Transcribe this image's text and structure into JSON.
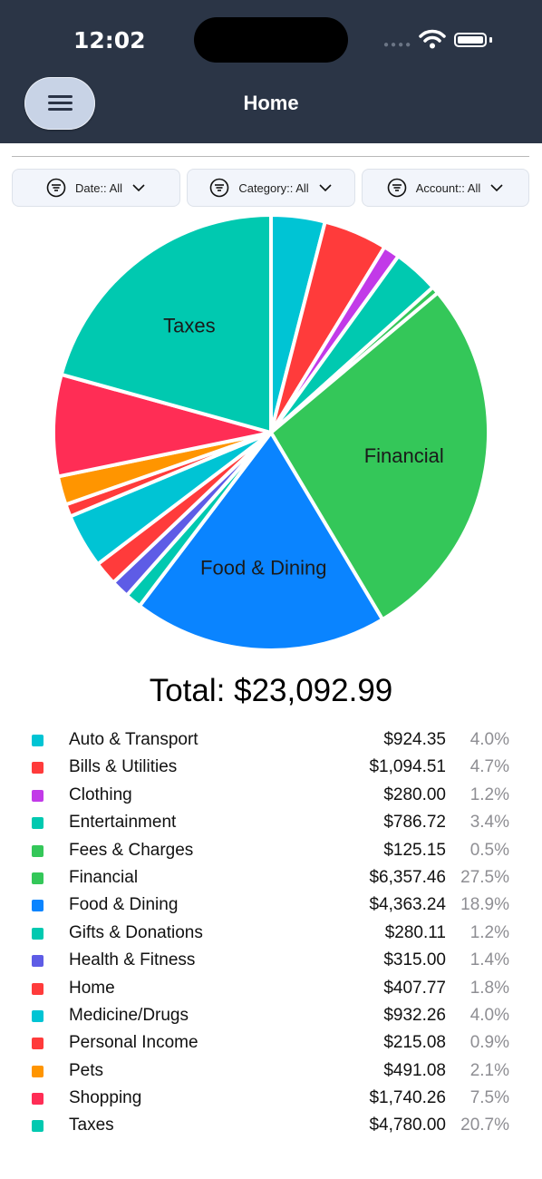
{
  "status": {
    "time": "12:02"
  },
  "header": {
    "title": "Home"
  },
  "filters": [
    {
      "label": "Date:: All"
    },
    {
      "label": "Category:: All"
    },
    {
      "label": "Account:: All"
    }
  ],
  "chart_data": {
    "type": "pie",
    "categories": [
      "Auto & Transport",
      "Bills & Utilities",
      "Clothing",
      "Entertainment",
      "Fees & Charges",
      "Financial",
      "Food & Dining",
      "Gifts & Donations",
      "Health & Fitness",
      "Home",
      "Medicine/Drugs",
      "Personal Income",
      "Pets",
      "Shopping",
      "Taxes"
    ],
    "values": [
      924.35,
      1094.51,
      280.0,
      786.72,
      125.15,
      6357.46,
      4363.24,
      280.11,
      315.0,
      407.77,
      932.26,
      215.08,
      491.08,
      1740.26,
      4780.0
    ],
    "colors": [
      "#00c4d4",
      "#ff3b3b",
      "#c23ae8",
      "#00c9b0",
      "#34c759",
      "#34c759",
      "#0a84ff",
      "#00c9b0",
      "#5e5ce6",
      "#ff3b3b",
      "#00c4d4",
      "#ff3b3b",
      "#ff9500",
      "#ff2d55",
      "#00c9b0"
    ],
    "slice_labels": [
      "",
      "",
      "",
      "",
      "",
      "Financial",
      "Food & Dining",
      "",
      "",
      "",
      "",
      "",
      "",
      "",
      "Taxes"
    ]
  },
  "total_label": "Total: $23,092.99",
  "legend": [
    {
      "name": "Auto & Transport",
      "amount": "$924.35",
      "percent": "4.0%",
      "color": "#00c4d4"
    },
    {
      "name": "Bills & Utilities",
      "amount": "$1,094.51",
      "percent": "4.7%",
      "color": "#ff3b3b"
    },
    {
      "name": "Clothing",
      "amount": "$280.00",
      "percent": "1.2%",
      "color": "#c23ae8"
    },
    {
      "name": "Entertainment",
      "amount": "$786.72",
      "percent": "3.4%",
      "color": "#00c9b0"
    },
    {
      "name": "Fees & Charges",
      "amount": "$125.15",
      "percent": "0.5%",
      "color": "#34c759"
    },
    {
      "name": "Financial",
      "amount": "$6,357.46",
      "percent": "27.5%",
      "color": "#34c759"
    },
    {
      "name": "Food & Dining",
      "amount": "$4,363.24",
      "percent": "18.9%",
      "color": "#0a84ff"
    },
    {
      "name": "Gifts & Donations",
      "amount": "$280.11",
      "percent": "1.2%",
      "color": "#00c9b0"
    },
    {
      "name": "Health & Fitness",
      "amount": "$315.00",
      "percent": "1.4%",
      "color": "#5e5ce6"
    },
    {
      "name": "Home",
      "amount": "$407.77",
      "percent": "1.8%",
      "color": "#ff3b3b"
    },
    {
      "name": "Medicine/Drugs",
      "amount": "$932.26",
      "percent": "4.0%",
      "color": "#00c4d4"
    },
    {
      "name": "Personal Income",
      "amount": "$215.08",
      "percent": "0.9%",
      "color": "#ff3b3b"
    },
    {
      "name": "Pets",
      "amount": "$491.08",
      "percent": "2.1%",
      "color": "#ff9500"
    },
    {
      "name": "Shopping",
      "amount": "$1,740.26",
      "percent": "7.5%",
      "color": "#ff2d55"
    },
    {
      "name": "Taxes",
      "amount": "$4,780.00",
      "percent": "20.7%",
      "color": "#00c9b0"
    }
  ]
}
